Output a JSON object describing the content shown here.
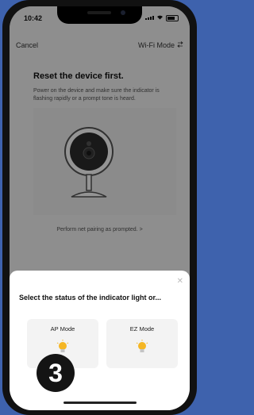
{
  "status_bar": {
    "time": "10:42"
  },
  "nav": {
    "cancel": "Cancel",
    "mode": "Wi-Fi Mode"
  },
  "content": {
    "title": "Reset the device first.",
    "description": "Power on the device and make sure the indicator is flashing rapidly or a prompt tone is heard.",
    "pairing_link": "Perform net pairing as prompted. >"
  },
  "sheet": {
    "title": "Select the status of the indicator light or...",
    "close_icon": "close-icon",
    "modes": [
      {
        "label": "AP Mode",
        "icon": "bulb-icon"
      },
      {
        "label": "EZ Mode",
        "icon": "bulb-icon"
      }
    ]
  },
  "step_badge": "3",
  "colors": {
    "bulb": "#f5b623",
    "frame": "#3e62ad",
    "overlay": "rgba(0,0,0,0.42)"
  }
}
